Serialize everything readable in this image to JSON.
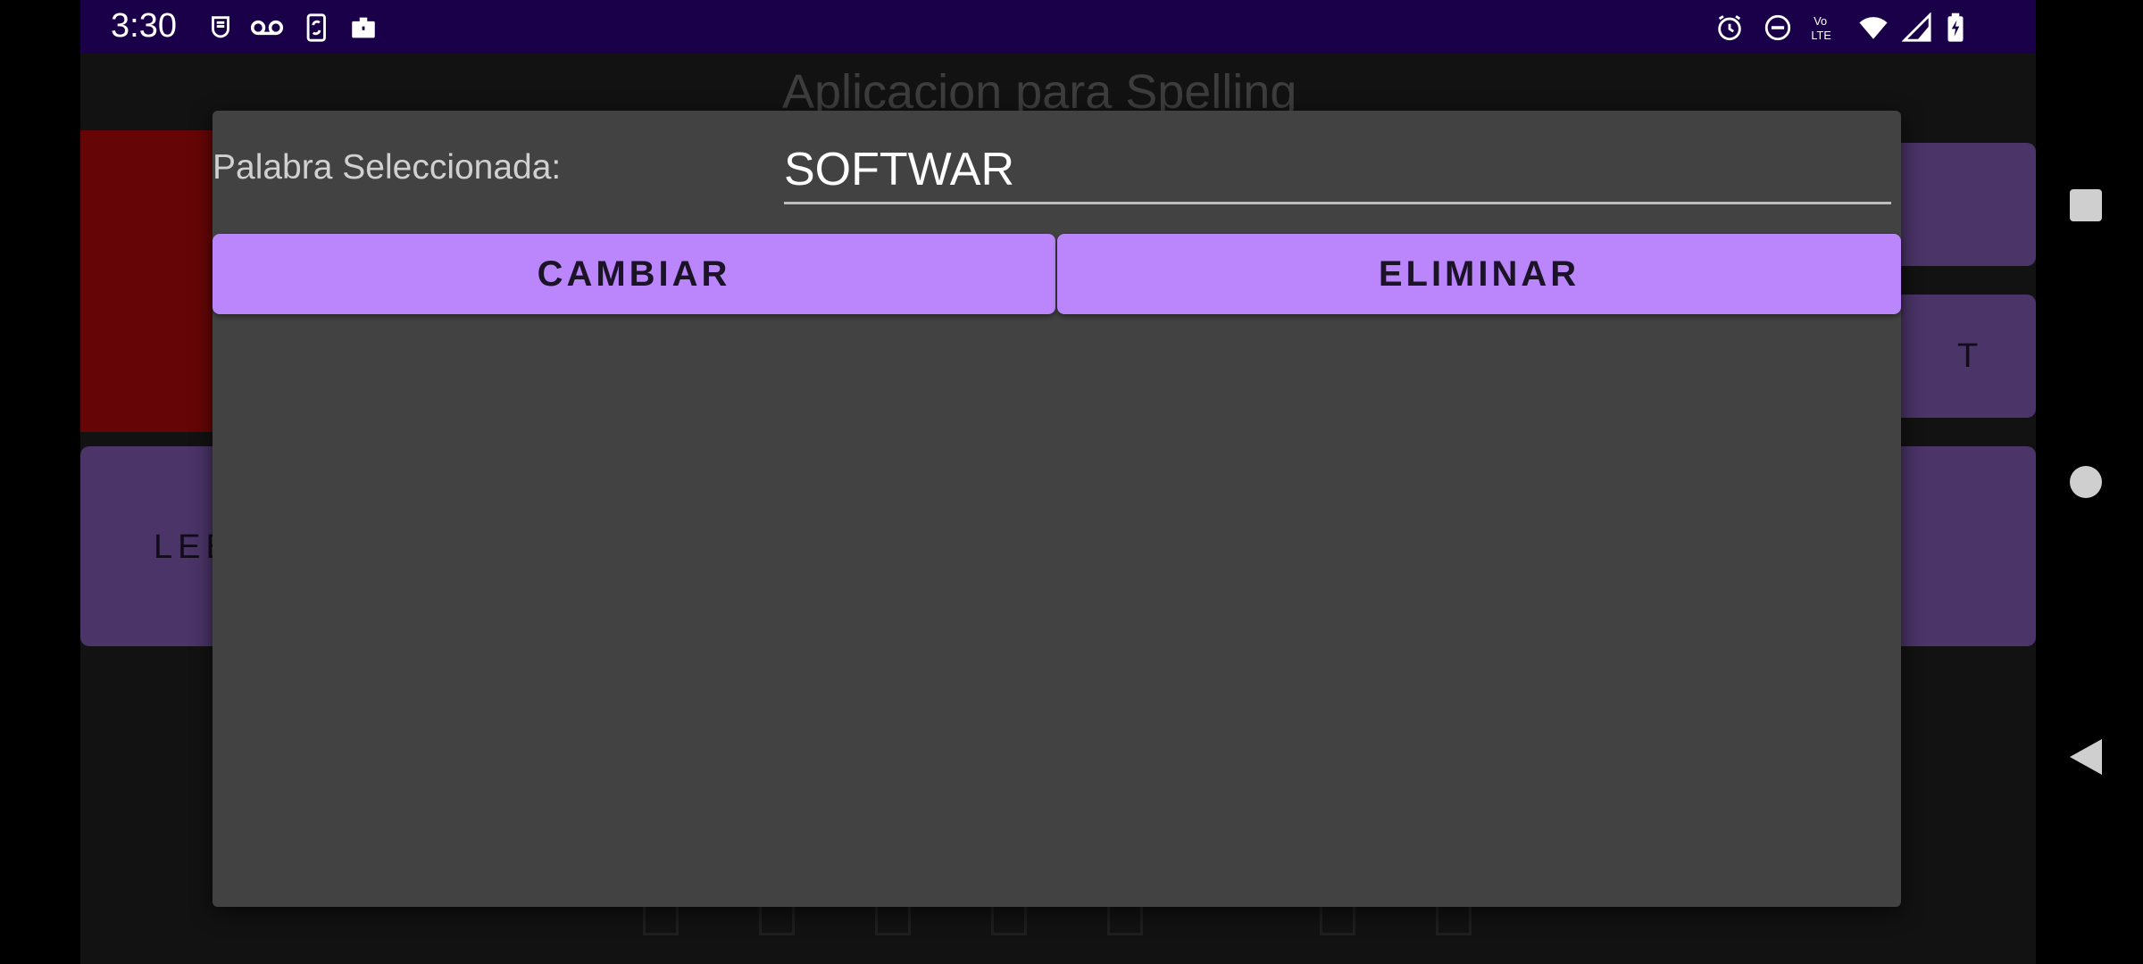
{
  "status_bar": {
    "time": "3:30",
    "left_icons": [
      "assistant-icon",
      "voicemail-icon",
      "phone-sync-icon",
      "work-briefcase-icon"
    ],
    "right_icons": [
      "alarm-icon",
      "do-not-disturb-icon",
      "volte-icon",
      "wifi-icon",
      "cell-signal-icon",
      "battery-charging-icon"
    ],
    "volte_text_top": "Vo",
    "volte_text_bottom": "LTE"
  },
  "app": {
    "title": "Aplicacion para Spelling",
    "left_button_partial": "LEE",
    "right_button_partial": "T"
  },
  "dialog": {
    "label": "Palabra Seleccionada:",
    "word_value": "SOFTWAR",
    "change_button": "CAMBIAR",
    "delete_button": "ELIMINAR"
  },
  "nav_bar": {
    "icons": [
      "recents-square-icon",
      "home-circle-icon",
      "back-triangle-icon"
    ]
  },
  "colors": {
    "status_bar": "#1a0048",
    "dialog_bg": "#424242",
    "accent": "#bb86fc",
    "background_button": "#4b3468",
    "background_red": "#660505"
  }
}
